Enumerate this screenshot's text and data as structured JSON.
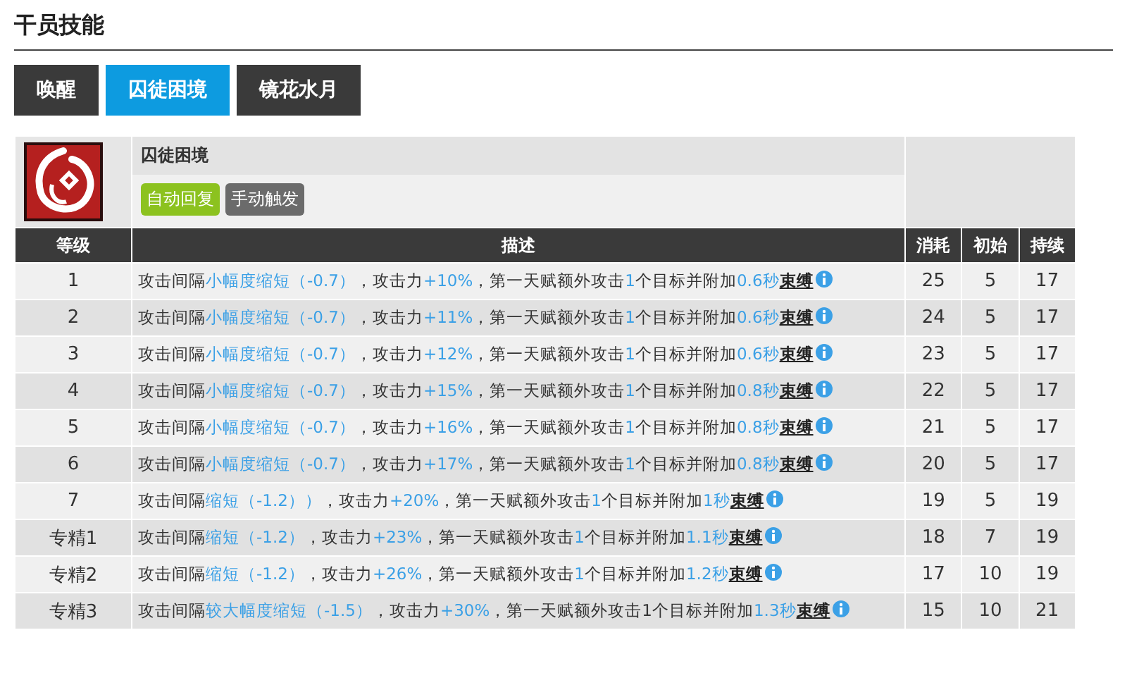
{
  "section_title": "干员技能",
  "tabs": [
    {
      "label": "唤醒",
      "selected": false
    },
    {
      "label": "囚徒困境",
      "selected": true
    },
    {
      "label": "镜花水月",
      "selected": false
    }
  ],
  "skill": {
    "name": "囚徒困境",
    "tags": [
      {
        "label": "自动回复",
        "color": "#8cc21f"
      },
      {
        "label": "手动触发",
        "color": "#6b6b6b"
      }
    ]
  },
  "table": {
    "columns": [
      "等级",
      "描述",
      "消耗",
      "初始",
      "持续"
    ],
    "rows": [
      {
        "level": "1",
        "description": [
          {
            "kind": "text",
            "text": "攻击间隔"
          },
          {
            "kind": "value",
            "text": "小幅度缩短（-0.7）"
          },
          {
            "kind": "text",
            "text": "，攻击力"
          },
          {
            "kind": "value",
            "text": "+10%"
          },
          {
            "kind": "text",
            "text": "，第一天赋额外攻击"
          },
          {
            "kind": "value",
            "text": "1"
          },
          {
            "kind": "text",
            "text": "个目标并附加"
          },
          {
            "kind": "value",
            "text": "0.6秒"
          },
          {
            "kind": "term",
            "text": "束缚"
          }
        ],
        "cost": "25",
        "initial": "5",
        "duration": "17"
      },
      {
        "level": "2",
        "description": [
          {
            "kind": "text",
            "text": "攻击间隔"
          },
          {
            "kind": "value",
            "text": "小幅度缩短（-0.7）"
          },
          {
            "kind": "text",
            "text": "，攻击力"
          },
          {
            "kind": "value",
            "text": "+11%"
          },
          {
            "kind": "text",
            "text": "，第一天赋额外攻击"
          },
          {
            "kind": "value",
            "text": "1"
          },
          {
            "kind": "text",
            "text": "个目标并附加"
          },
          {
            "kind": "value",
            "text": "0.6秒"
          },
          {
            "kind": "term",
            "text": "束缚"
          }
        ],
        "cost": "24",
        "initial": "5",
        "duration": "17"
      },
      {
        "level": "3",
        "description": [
          {
            "kind": "text",
            "text": "攻击间隔"
          },
          {
            "kind": "value",
            "text": "小幅度缩短（-0.7）"
          },
          {
            "kind": "text",
            "text": "，攻击力"
          },
          {
            "kind": "value",
            "text": "+12%"
          },
          {
            "kind": "text",
            "text": "，第一天赋额外攻击"
          },
          {
            "kind": "value",
            "text": "1"
          },
          {
            "kind": "text",
            "text": "个目标并附加"
          },
          {
            "kind": "value",
            "text": "0.6秒"
          },
          {
            "kind": "term",
            "text": "束缚"
          }
        ],
        "cost": "23",
        "initial": "5",
        "duration": "17"
      },
      {
        "level": "4",
        "description": [
          {
            "kind": "text",
            "text": "攻击间隔"
          },
          {
            "kind": "value",
            "text": "小幅度缩短（-0.7）"
          },
          {
            "kind": "text",
            "text": "，攻击力"
          },
          {
            "kind": "value",
            "text": "+15%"
          },
          {
            "kind": "text",
            "text": "，第一天赋额外攻击"
          },
          {
            "kind": "value",
            "text": "1"
          },
          {
            "kind": "text",
            "text": "个目标并附加"
          },
          {
            "kind": "value",
            "text": "0.8秒"
          },
          {
            "kind": "term",
            "text": "束缚"
          }
        ],
        "cost": "22",
        "initial": "5",
        "duration": "17"
      },
      {
        "level": "5",
        "description": [
          {
            "kind": "text",
            "text": "攻击间隔"
          },
          {
            "kind": "value",
            "text": "小幅度缩短（-0.7）"
          },
          {
            "kind": "text",
            "text": "，攻击力"
          },
          {
            "kind": "value",
            "text": "+16%"
          },
          {
            "kind": "text",
            "text": "，第一天赋额外攻击"
          },
          {
            "kind": "value",
            "text": "1"
          },
          {
            "kind": "text",
            "text": "个目标并附加"
          },
          {
            "kind": "value",
            "text": "0.8秒"
          },
          {
            "kind": "term",
            "text": "束缚"
          }
        ],
        "cost": "21",
        "initial": "5",
        "duration": "17"
      },
      {
        "level": "6",
        "description": [
          {
            "kind": "text",
            "text": "攻击间隔"
          },
          {
            "kind": "value",
            "text": "小幅度缩短（-0.7）"
          },
          {
            "kind": "text",
            "text": "，攻击力"
          },
          {
            "kind": "value",
            "text": "+17%"
          },
          {
            "kind": "text",
            "text": "，第一天赋额外攻击"
          },
          {
            "kind": "value",
            "text": "1"
          },
          {
            "kind": "text",
            "text": "个目标并附加"
          },
          {
            "kind": "value",
            "text": "0.8秒"
          },
          {
            "kind": "term",
            "text": "束缚"
          }
        ],
        "cost": "20",
        "initial": "5",
        "duration": "17"
      },
      {
        "level": "7",
        "description": [
          {
            "kind": "text",
            "text": "攻击间隔"
          },
          {
            "kind": "value",
            "text": "缩短（-1.2））"
          },
          {
            "kind": "text",
            "text": "，攻击力"
          },
          {
            "kind": "value",
            "text": "+20%"
          },
          {
            "kind": "text",
            "text": "，第一天赋额外攻击"
          },
          {
            "kind": "value",
            "text": "1"
          },
          {
            "kind": "text",
            "text": "个目标并附加"
          },
          {
            "kind": "value",
            "text": "1秒"
          },
          {
            "kind": "term",
            "text": "束缚"
          }
        ],
        "cost": "19",
        "initial": "5",
        "duration": "19"
      },
      {
        "level": "专精1",
        "description": [
          {
            "kind": "text",
            "text": "攻击间隔"
          },
          {
            "kind": "value",
            "text": "缩短（-1.2）"
          },
          {
            "kind": "text",
            "text": "，攻击力"
          },
          {
            "kind": "value",
            "text": "+23%"
          },
          {
            "kind": "text",
            "text": "，第一天赋额外攻击"
          },
          {
            "kind": "value",
            "text": "1"
          },
          {
            "kind": "text",
            "text": "个目标并附加"
          },
          {
            "kind": "value",
            "text": "1.1秒"
          },
          {
            "kind": "term",
            "text": "束缚"
          }
        ],
        "cost": "18",
        "initial": "7",
        "duration": "19"
      },
      {
        "level": "专精2",
        "description": [
          {
            "kind": "text",
            "text": "攻击间隔"
          },
          {
            "kind": "value",
            "text": "缩短（-1.2）"
          },
          {
            "kind": "text",
            "text": "，攻击力"
          },
          {
            "kind": "value",
            "text": "+26%"
          },
          {
            "kind": "text",
            "text": "，第一天赋额外攻击"
          },
          {
            "kind": "value",
            "text": "1"
          },
          {
            "kind": "text",
            "text": "个目标并附加"
          },
          {
            "kind": "value",
            "text": "1.2秒"
          },
          {
            "kind": "term",
            "text": "束缚"
          }
        ],
        "cost": "17",
        "initial": "10",
        "duration": "19"
      },
      {
        "level": "专精3",
        "description": [
          {
            "kind": "text",
            "text": "攻击间隔"
          },
          {
            "kind": "value",
            "text": "较大幅度缩短（-1.5）"
          },
          {
            "kind": "text",
            "text": "，攻击力"
          },
          {
            "kind": "value",
            "text": "+30%"
          },
          {
            "kind": "text",
            "text": "，第一天赋额外攻击1个目标并附加"
          },
          {
            "kind": "value",
            "text": "1.3秒"
          },
          {
            "kind": "term",
            "text": "束缚"
          }
        ],
        "cost": "15",
        "initial": "10",
        "duration": "21"
      }
    ]
  }
}
